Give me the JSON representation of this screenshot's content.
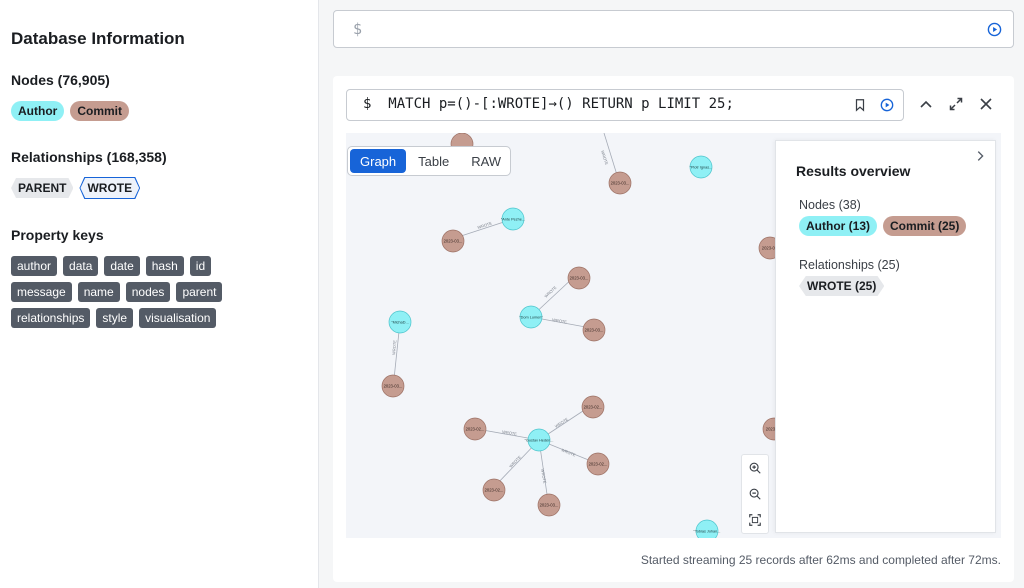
{
  "sidebar": {
    "title": "Database Information",
    "nodes_title": "Nodes (76,905)",
    "node_labels": [
      {
        "label": "Author",
        "color": "#8ff0f5"
      },
      {
        "label": "Commit",
        "color": "#c59c90"
      }
    ],
    "relationships_title": "Relationships (168,358)",
    "relationship_types": [
      "PARENT",
      "WROTE"
    ],
    "property_keys_title": "Property keys",
    "property_keys": [
      "author",
      "data",
      "date",
      "hash",
      "id",
      "message",
      "name",
      "nodes",
      "parent",
      "relationships",
      "style",
      "visualisation"
    ]
  },
  "top_editor": {
    "prompt": "$"
  },
  "frame": {
    "prompt": "$",
    "query": "MATCH p=()-[:WROTE]→() RETURN p LIMIT 25;",
    "view_tabs": [
      "Graph",
      "Table",
      "RAW"
    ],
    "active_tab": "Graph",
    "overview": {
      "title": "Results overview",
      "nodes_title": "Nodes (38)",
      "node_labels": [
        {
          "label": "Author (13)",
          "color": "#8ff0f5"
        },
        {
          "label": "Commit (25)",
          "color": "#c59c90"
        }
      ],
      "relationships_title": "Relationships (25)",
      "relationship_labels": [
        "WROTE (25)"
      ]
    },
    "status": "Started streaming 25 records after 62ms and completed after 72ms."
  },
  "graph": {
    "author_color": "#8ff0f5",
    "commit_color": "#c59c90",
    "edge_label": "WROTE",
    "authors": [
      {
        "label": "\"Piotr Ignas...",
        "id": "a1"
      },
      {
        "label": "\"Ante Pezhe...",
        "id": "a2"
      },
      {
        "label": "\"Dom Lumen\"",
        "id": "a3"
      },
      {
        "label": "\"MichaD...",
        "id": "a4"
      },
      {
        "label": "\"Gustav Hedén...",
        "id": "a5"
      },
      {
        "label": "\"Tobias Johan...",
        "id": "a6"
      }
    ],
    "commits": [
      {
        "label": "2023-03...",
        "id": "c1"
      },
      {
        "label": "2023-03...",
        "id": "c2"
      },
      {
        "label": "2023-03...",
        "id": "c3"
      },
      {
        "label": "2023-03...",
        "id": "c4"
      },
      {
        "label": "2023-03...",
        "id": "c5"
      },
      {
        "label": "2023-02...",
        "id": "c6"
      },
      {
        "label": "2023-02...",
        "id": "c7"
      },
      {
        "label": "2023-02...",
        "id": "c8"
      },
      {
        "label": "2023-02...",
        "id": "c9"
      },
      {
        "label": "2023-03...",
        "id": "c10"
      },
      {
        "label": "2023-0...",
        "id": "c11"
      },
      {
        "label": "2023-0...",
        "id": "c12"
      }
    ]
  },
  "icons": {
    "run": "play-circle-icon",
    "pin": "bookmark-icon",
    "collapse": "chevron-up-icon",
    "fullscreen": "expand-icon",
    "close": "close-icon",
    "overview_toggle": "chevron-right-icon",
    "zoom_in": "zoom-in-icon",
    "zoom_out": "zoom-out-icon",
    "fit": "fit-to-screen-icon"
  }
}
